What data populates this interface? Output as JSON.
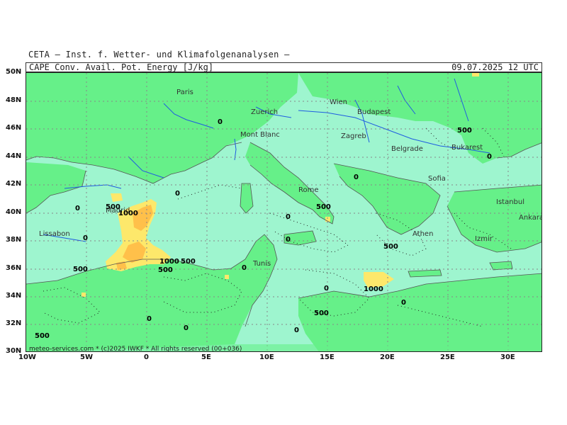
{
  "header": {
    "institute": "CETA – Inst. f. Wetter- und Klimafolgenanalysen –",
    "parameter": "CAPE_Conv._Avail._Pot._Energy_[J/kg]",
    "valid_time": "09.07.2025 12 UTC"
  },
  "footer": {
    "credit": "meteo-services.com * (c)2025 IWKF * All rights reserved (00+036)"
  },
  "colors": {
    "cape_low": "#9ef5cf",
    "cape_mid": "#66f089",
    "cape_500": "#fde86b",
    "cape_1000": "#ffc04a",
    "rivers": "#1f5ce0",
    "borders": "#555555",
    "grid": "#888888"
  },
  "axes": {
    "lat_labels": [
      "50N",
      "48N",
      "46N",
      "44N",
      "42N",
      "40N",
      "38N",
      "36N",
      "34N",
      "32N",
      "30N"
    ],
    "lon_labels": [
      "10W",
      "5W",
      "0",
      "5E",
      "10E",
      "15E",
      "20E",
      "25E",
      "30E"
    ]
  },
  "cities": [
    {
      "name": "Paris"
    },
    {
      "name": "Wien"
    },
    {
      "name": "Zuerich"
    },
    {
      "name": "Budapest"
    },
    {
      "name": "Mont Blanc"
    },
    {
      "name": "Zagreb"
    },
    {
      "name": "Belgrade"
    },
    {
      "name": "Bukarest"
    },
    {
      "name": "Rome"
    },
    {
      "name": "Sofia"
    },
    {
      "name": "Madrid"
    },
    {
      "name": "Istanbul"
    },
    {
      "name": "Ankara"
    },
    {
      "name": "Lissabon"
    },
    {
      "name": "Athen"
    },
    {
      "name": "Izmir"
    },
    {
      "name": "Tunis"
    }
  ],
  "contour_labels": [
    {
      "text": "0"
    },
    {
      "text": "500"
    },
    {
      "text": "0"
    },
    {
      "text": "500"
    },
    {
      "text": "1000"
    },
    {
      "text": "0"
    },
    {
      "text": "0"
    },
    {
      "text": "500"
    },
    {
      "text": "0"
    },
    {
      "text": "0"
    },
    {
      "text": "500"
    },
    {
      "text": "1000"
    },
    {
      "text": "500"
    },
    {
      "text": "500"
    },
    {
      "text": "0"
    },
    {
      "text": "0"
    },
    {
      "text": "1000"
    },
    {
      "text": "0"
    },
    {
      "text": "500"
    },
    {
      "text": "0"
    },
    {
      "text": "500"
    },
    {
      "text": "0"
    },
    {
      "text": "0"
    },
    {
      "text": "500"
    },
    {
      "text": "0"
    },
    {
      "text": "0"
    }
  ]
}
